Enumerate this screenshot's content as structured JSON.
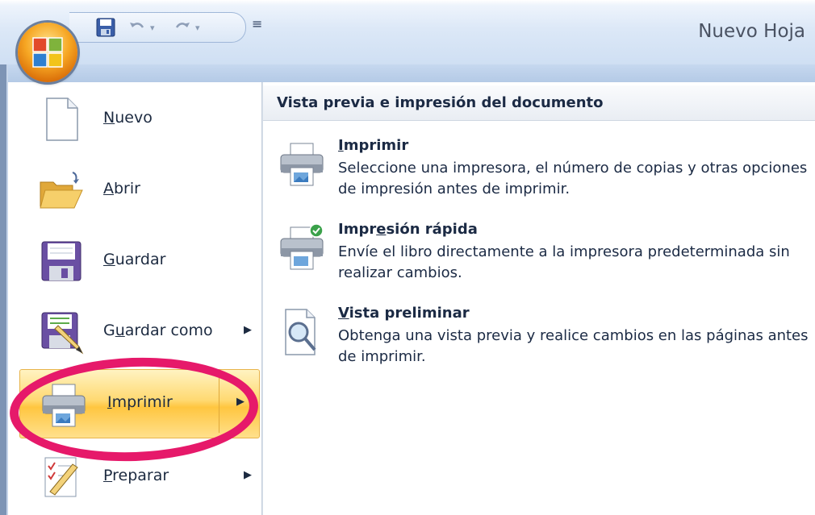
{
  "window": {
    "title": "Nuevo Hoja"
  },
  "quick_access": {
    "items": [
      {
        "name": "save",
        "icon": "save-icon"
      },
      {
        "name": "undo",
        "icon": "undo-icon"
      },
      {
        "name": "redo",
        "icon": "redo-icon"
      }
    ],
    "customize_glyph": "≡"
  },
  "office_menu": {
    "items": [
      {
        "pre": "",
        "ul": "N",
        "post": "uevo",
        "arrow": false,
        "icon": "new-document-icon"
      },
      {
        "pre": "",
        "ul": "A",
        "post": "brir",
        "arrow": false,
        "icon": "open-folder-icon"
      },
      {
        "pre": "",
        "ul": "G",
        "post": "uardar",
        "arrow": false,
        "icon": "save-icon"
      },
      {
        "pre": "G",
        "ul": "u",
        "post": "ardar como",
        "arrow": true,
        "icon": "save-as-icon"
      },
      {
        "pre": "",
        "ul": "I",
        "post": "mprimir",
        "arrow": true,
        "icon": "printer-icon",
        "selected": true
      },
      {
        "pre": "",
        "ul": "P",
        "post": "reparar",
        "arrow": true,
        "icon": "prepare-icon"
      }
    ]
  },
  "print_panel": {
    "header": "Vista previa e impresión del documento",
    "options": [
      {
        "title_pre": "",
        "title_ul": "I",
        "title_post": "mprimir",
        "description": "Seleccione una impresora, el número de copias y otras opciones de impresión antes de imprimir.",
        "icon": "printer-icon"
      },
      {
        "title_pre": "Impr",
        "title_ul": "e",
        "title_post": "sión rápida",
        "description": "Envíe el libro directamente a la impresora predeterminada sin realizar cambios.",
        "icon": "quick-print-icon"
      },
      {
        "title_pre": "",
        "title_ul": "V",
        "title_post": "ista preliminar",
        "description": "Obtenga una vista previa y realice cambios en las páginas antes de imprimir.",
        "icon": "print-preview-icon"
      }
    ]
  },
  "colors": {
    "highlight_ring": "#e6196a",
    "selected_item": "#ffd971",
    "office_button": "#f6a623"
  }
}
